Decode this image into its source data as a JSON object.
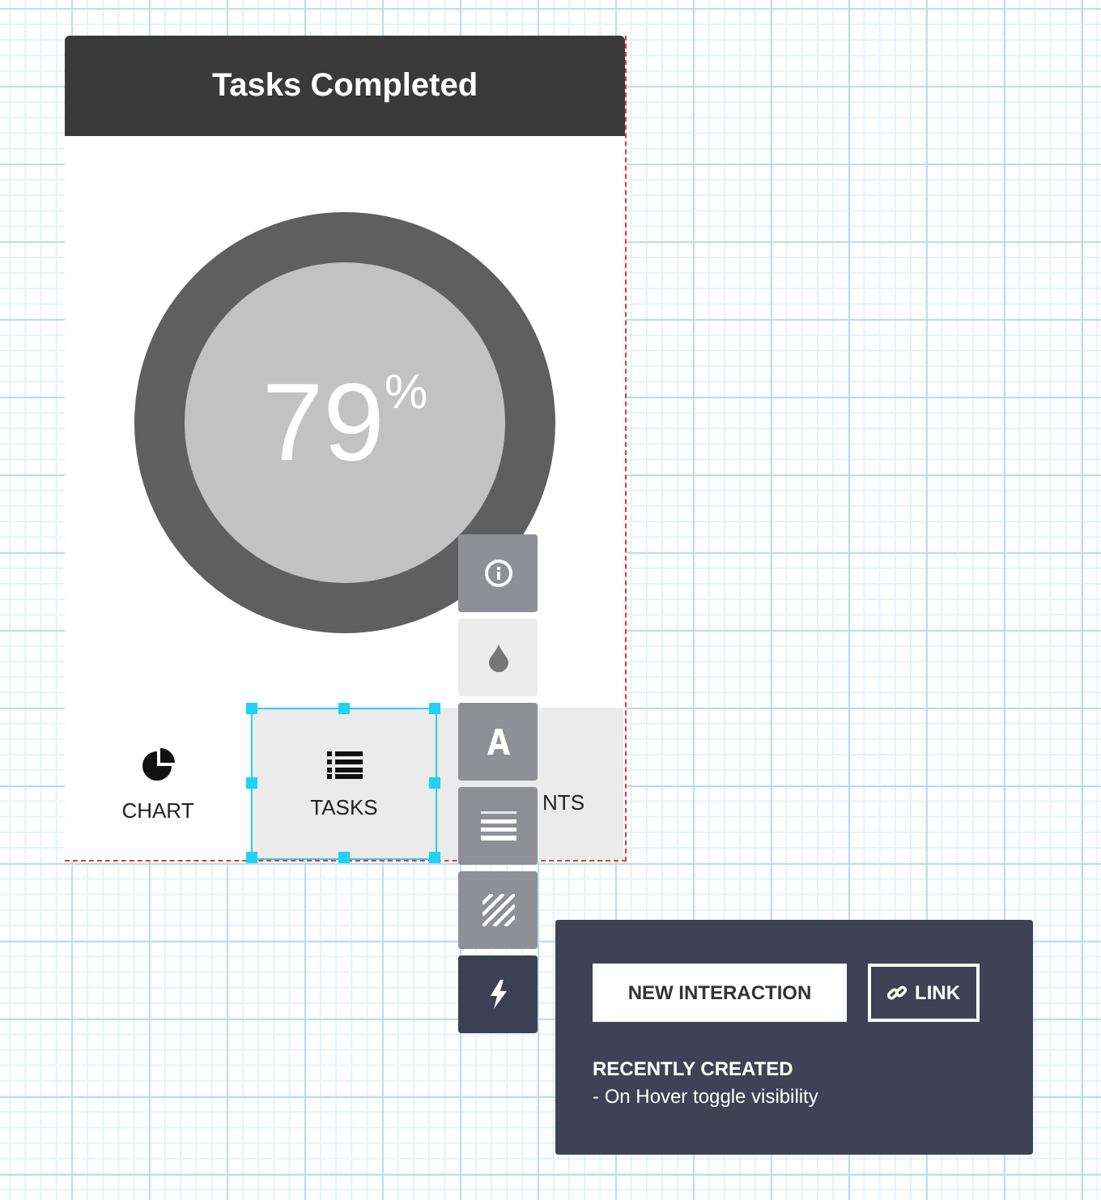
{
  "widget": {
    "title": "Tasks Completed",
    "value": "79",
    "unit": "%",
    "tabs": [
      {
        "label": "CHART",
        "kind": "chart",
        "selected": false,
        "highlighted": false
      },
      {
        "label": "TASKS",
        "kind": "list",
        "selected": true,
        "highlighted": true
      },
      {
        "label": "NTS",
        "kind": "covered",
        "selected": false,
        "highlighted": true
      }
    ]
  },
  "toolbar": [
    {
      "kind": "info",
      "selected": false,
      "disabled": false
    },
    {
      "kind": "color",
      "selected": false,
      "disabled": true
    },
    {
      "kind": "text",
      "selected": false,
      "disabled": false
    },
    {
      "kind": "lines",
      "selected": false,
      "disabled": false
    },
    {
      "kind": "pattern",
      "selected": false,
      "disabled": false
    },
    {
      "kind": "interaction",
      "selected": true,
      "disabled": false
    }
  ],
  "interaction_panel": {
    "buttons": [
      {
        "label": "NEW INTERACTION",
        "kind": "plain"
      },
      {
        "label": "LINK",
        "kind": "link"
      }
    ],
    "heading": "RECENTLY CREATED",
    "items": [
      "- On Hover toggle visibility"
    ]
  }
}
